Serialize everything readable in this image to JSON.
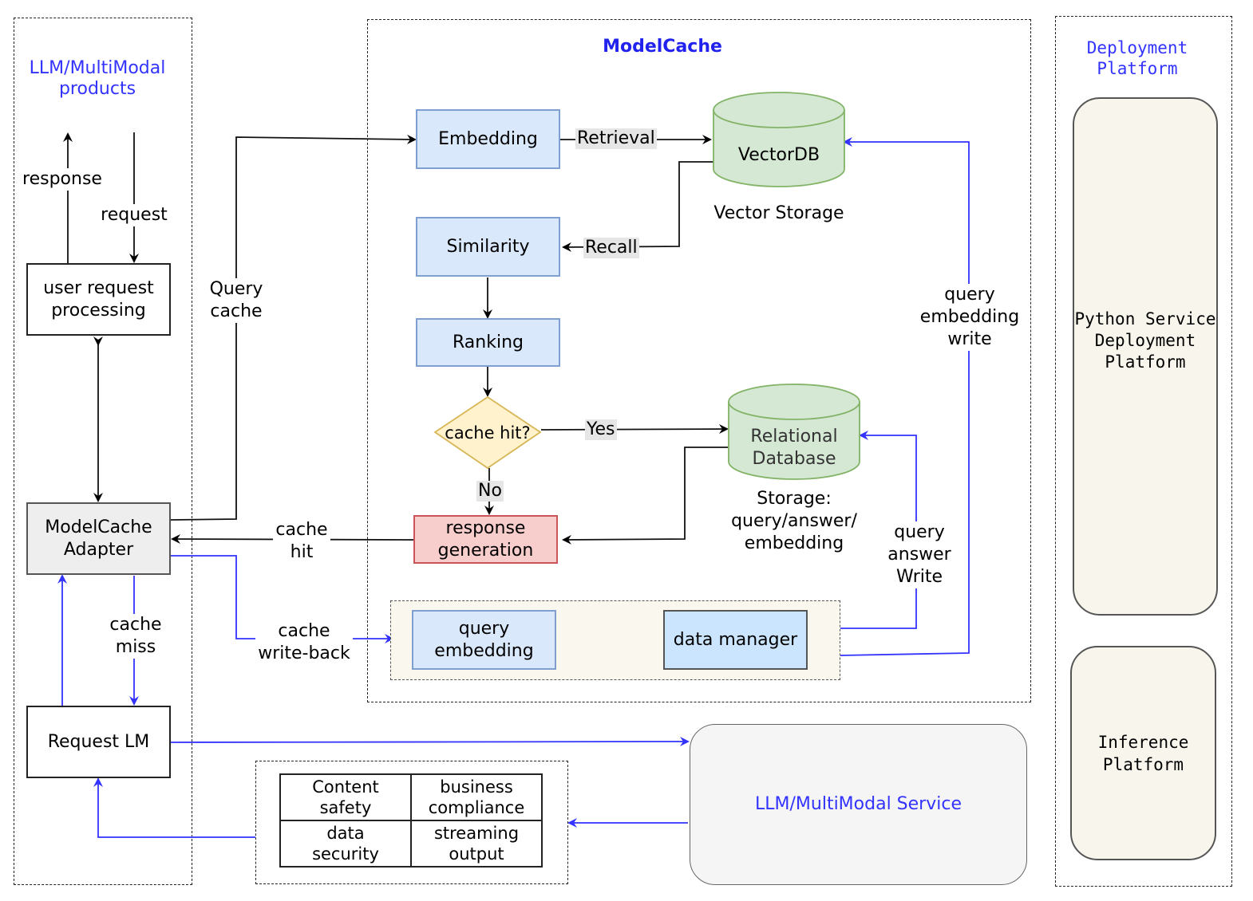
{
  "regions": {
    "products": {
      "title_line1": "LLM/MultiModal",
      "title_line2": "products"
    },
    "modelcache": {
      "title": "ModelCache"
    },
    "deployment": {
      "title_line1": "Deployment",
      "title_line2": "Platform"
    }
  },
  "left": {
    "response_label": "response",
    "request_label": "request",
    "user_request_processing": [
      "user request",
      "processing"
    ],
    "adapter": [
      "ModelCache",
      "Adapter"
    ],
    "cache_miss": [
      "cache",
      "miss"
    ],
    "request_lm": "Request LM"
  },
  "flow": {
    "query_cache": [
      "Query",
      "cache"
    ],
    "cache_hit": [
      "cache",
      "hit"
    ],
    "cache_write_back": [
      "cache",
      "write-back"
    ]
  },
  "modelcache": {
    "embedding": "Embedding",
    "retrieval": "Retrieval",
    "vectordb": "VectorDB",
    "vector_storage": "Vector Storage",
    "similarity": "Similarity",
    "recall": "Recall",
    "ranking": "Ranking",
    "cache_hit_q": "cache hit?",
    "yes": "Yes",
    "no": "No",
    "relational_db": [
      "Relational",
      "Database"
    ],
    "storage_caption": [
      "Storage:",
      "query/answer/",
      "embedding"
    ],
    "response_generation": [
      "response",
      "generation"
    ],
    "query_embedding_write": [
      "query",
      "embedding",
      "write"
    ],
    "query_answer_write": [
      "query",
      "answer",
      "Write"
    ],
    "query_embedding": [
      "query",
      "embedding"
    ],
    "data_manager": "data manager"
  },
  "service": {
    "llm_service": "LLM/MultiModal Service",
    "grid": [
      [
        "Content",
        "safety"
      ],
      [
        "business",
        "compliance"
      ],
      [
        "data",
        "security"
      ],
      [
        "streaming",
        "output"
      ]
    ]
  },
  "deployment": {
    "python_platform": [
      "Python Service",
      "Deployment",
      "Platform"
    ],
    "inference_platform": [
      "Inference",
      "Platform"
    ]
  },
  "colors": {
    "accent_blue": "#3333ff",
    "embedding_fill": "#dae8fc",
    "db_fill": "#d5e8d4",
    "decision_fill": "#fff2cc",
    "response_fill": "#f8cecc"
  }
}
